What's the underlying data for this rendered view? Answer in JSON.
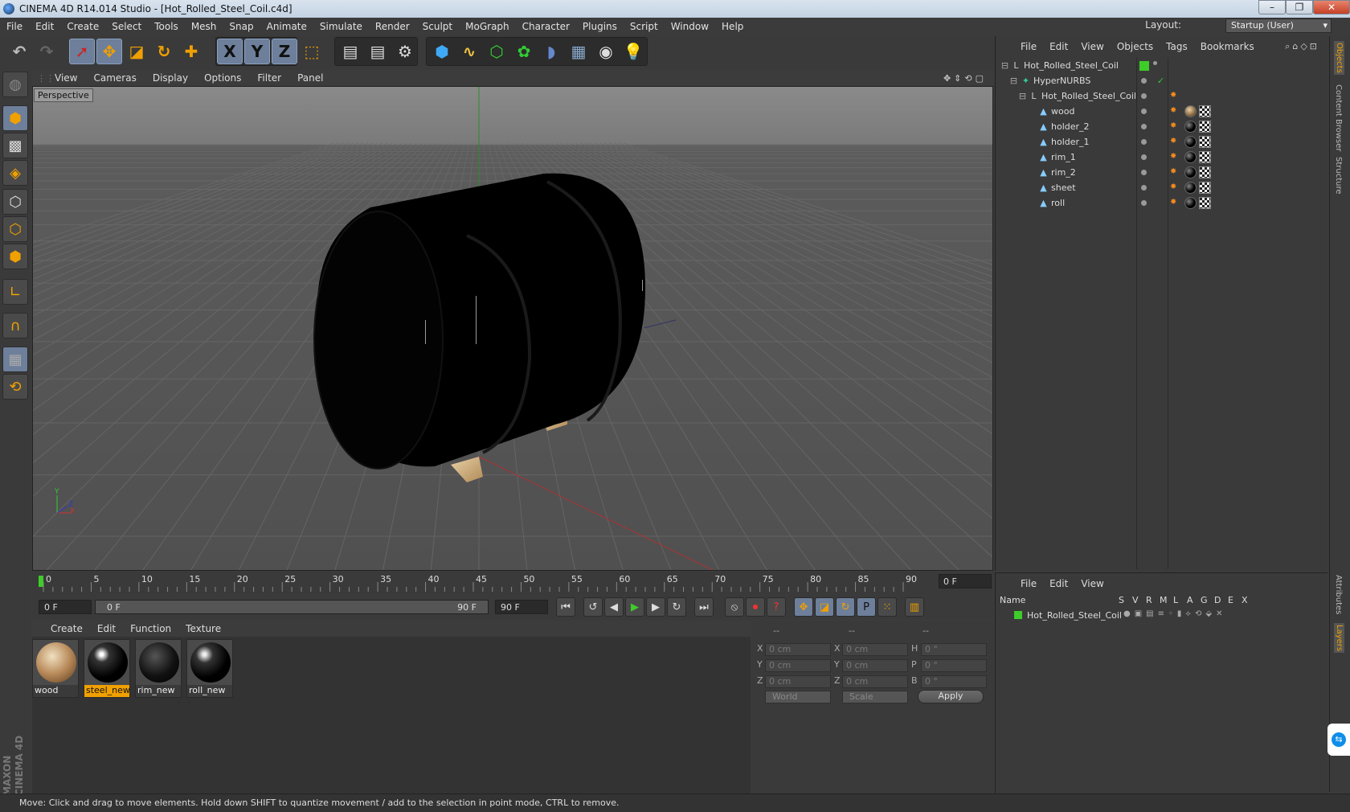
{
  "window": {
    "title": "CINEMA 4D R14.014 Studio - [Hot_Rolled_Steel_Coil.c4d]",
    "minimize_glyph": "–",
    "restore_glyph": "❐",
    "close_glyph": "✕"
  },
  "menubar": [
    "File",
    "Edit",
    "Create",
    "Select",
    "Tools",
    "Mesh",
    "Snap",
    "Animate",
    "Simulate",
    "Render",
    "Sculpt",
    "MoGraph",
    "Character",
    "Plugins",
    "Script",
    "Window",
    "Help"
  ],
  "layout": {
    "label": "Layout:",
    "value": "Startup (User)"
  },
  "toolbar": {
    "axis_x": "X",
    "axis_y": "Y",
    "axis_z": "Z",
    "icons": [
      "undo-icon",
      "redo-icon",
      "select-icon",
      "move-icon",
      "scale-icon",
      "rotate-icon",
      "add-icon",
      "x-axis-icon",
      "y-axis-icon",
      "z-axis-icon",
      "coordinate-system-icon",
      "render-view-icon",
      "render-picture-viewer-icon",
      "render-settings-icon",
      "cube-icon",
      "spline-icon",
      "nurbs-icon",
      "array-icon",
      "deformer-icon",
      "floor-icon",
      "camera-icon",
      "light-icon"
    ]
  },
  "viewport": {
    "menu": [
      "View",
      "Cameras",
      "Display",
      "Options",
      "Filter",
      "Panel"
    ],
    "label": "Perspective",
    "axis_x": "X",
    "axis_y": "Y",
    "axis_z": "Z"
  },
  "timeline": {
    "ticks": [
      "0",
      "5",
      "10",
      "15",
      "20",
      "25",
      "30",
      "35",
      "40",
      "45",
      "50",
      "55",
      "60",
      "65",
      "70",
      "75",
      "80",
      "85",
      "90"
    ],
    "current_frame": "0 F"
  },
  "transport": {
    "start_field": "0 F",
    "range_left": "0 F",
    "range_right": "90 F",
    "end_field": "90 F"
  },
  "materials": {
    "menu": [
      "Create",
      "Edit",
      "Function",
      "Texture"
    ],
    "items": [
      {
        "name": "wood",
        "selected": false
      },
      {
        "name": "steel_new",
        "selected": true
      },
      {
        "name": "rim_new",
        "selected": false
      },
      {
        "name": "roll_new",
        "selected": false
      }
    ]
  },
  "coordinates": {
    "head": [
      "--",
      "--",
      "--"
    ],
    "rows": [
      {
        "a": "X",
        "av": "0 cm",
        "b": "X",
        "bv": "0 cm",
        "c": "H",
        "cv": "0 °"
      },
      {
        "a": "Y",
        "av": "0 cm",
        "b": "Y",
        "bv": "0 cm",
        "c": "P",
        "cv": "0 °"
      },
      {
        "a": "Z",
        "av": "0 cm",
        "b": "Z",
        "bv": "0 cm",
        "c": "B",
        "cv": "0 °"
      }
    ],
    "space": "World",
    "mode": "Scale",
    "apply": "Apply"
  },
  "objects": {
    "menu": [
      "File",
      "Edit",
      "View",
      "Objects",
      "Tags",
      "Bookmarks"
    ],
    "rows": [
      {
        "name": "Hot_Rolled_Steel_Coil",
        "depth": 0,
        "tags": "layer"
      },
      {
        "name": "HyperNURBS",
        "depth": 1,
        "tags": "check"
      },
      {
        "name": "Hot_Rolled_Steel_Coil",
        "depth": 2,
        "tags": "phong"
      },
      {
        "name": "wood",
        "depth": 3,
        "tags": "wood"
      },
      {
        "name": "holder_2",
        "depth": 3,
        "tags": "mat"
      },
      {
        "name": "holder_1",
        "depth": 3,
        "tags": "mat"
      },
      {
        "name": "rim_1",
        "depth": 3,
        "tags": "mat"
      },
      {
        "name": "rim_2",
        "depth": 3,
        "tags": "mat"
      },
      {
        "name": "sheet",
        "depth": 3,
        "tags": "mat"
      },
      {
        "name": "roll",
        "depth": 3,
        "tags": "mat"
      }
    ]
  },
  "layers": {
    "menu": [
      "File",
      "Edit",
      "View"
    ],
    "header": {
      "name": "Name",
      "cols": [
        "S",
        "V",
        "R",
        "M",
        "L",
        "A",
        "G",
        "D",
        "E",
        "X"
      ]
    },
    "row": {
      "name": "Hot_Rolled_Steel_Coil",
      "color": "#3ecc2a"
    }
  },
  "side_tabs": [
    "Objects",
    "Content Browser",
    "Structure",
    "Attributes",
    "Layers"
  ],
  "brand": "MAXON CINEMA 4D",
  "status": "Move: Click and drag to move elements. Hold down SHIFT to quantize movement / add to the selection in point mode, CTRL to remove.",
  "colors": {
    "accent": "#f0a000",
    "selection": "#6d7f9a",
    "layer_green": "#3ecc2a"
  }
}
